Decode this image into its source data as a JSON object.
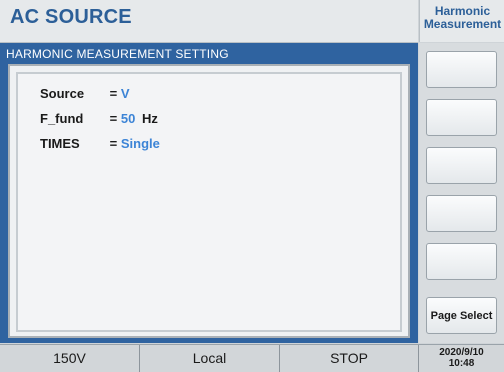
{
  "header": {
    "title": "AC SOURCE",
    "side_title_line1": "Harmonic",
    "side_title_line2": "Measurement"
  },
  "panel": {
    "header": "HARMONIC MEASUREMENT SETTING",
    "rows": [
      {
        "label": "Source",
        "eq": "=",
        "value": "V",
        "unit": ""
      },
      {
        "label": "F_fund",
        "eq": "=",
        "value": "50",
        "unit": "Hz"
      },
      {
        "label": "TIMES",
        "eq": "=",
        "value": "Single",
        "unit": ""
      }
    ]
  },
  "side_buttons": [
    "",
    "",
    "",
    "",
    "",
    "Page Select"
  ],
  "status": {
    "voltage_range": "150V",
    "mode": "Local",
    "state": "STOP",
    "date": "2020/9/10",
    "time": "10:48"
  },
  "colors": {
    "title": "#2c5f98",
    "frame": "#2f63a0",
    "value": "#3c84d6"
  }
}
